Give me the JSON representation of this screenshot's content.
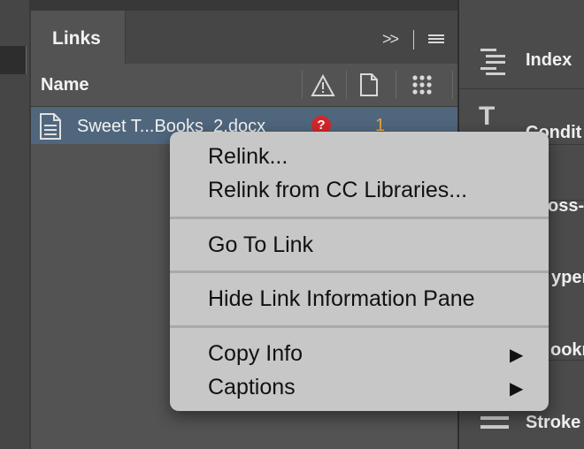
{
  "links_panel": {
    "tab_label": "Links",
    "columns": {
      "name": "Name"
    },
    "rows": [
      {
        "name": "Sweet T...Books_2.docx",
        "status": "?",
        "page": "1"
      }
    ]
  },
  "right_panel": {
    "items": [
      "Index",
      "Condit",
      "oss-",
      "yperl",
      "ookm",
      "Stroke"
    ]
  },
  "context_menu": {
    "items": [
      "Relink...",
      "Relink from CC Libraries...",
      "Go To Link",
      "Hide Link Information Pane",
      "Copy Info",
      "Captions"
    ],
    "submenu_arrow": "▶"
  }
}
